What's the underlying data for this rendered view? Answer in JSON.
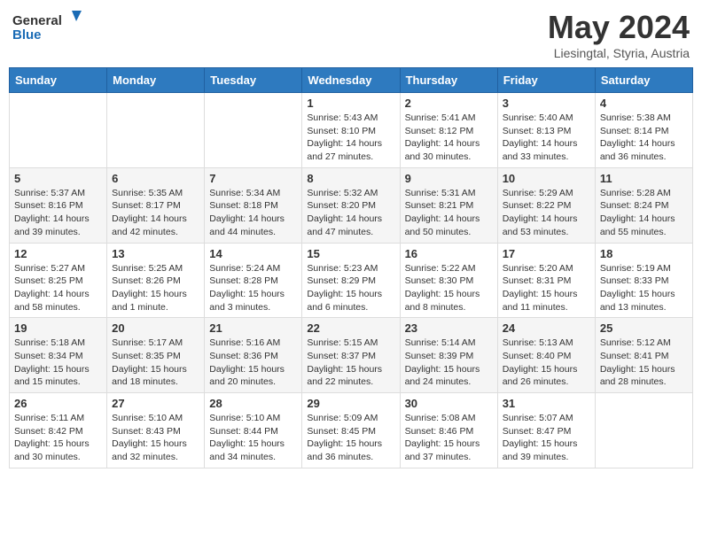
{
  "logo": {
    "line1": "General",
    "line2": "Blue"
  },
  "title": "May 2024",
  "location": "Liesingtal, Styria, Austria",
  "days_of_week": [
    "Sunday",
    "Monday",
    "Tuesday",
    "Wednesday",
    "Thursday",
    "Friday",
    "Saturday"
  ],
  "weeks": [
    [
      {
        "day": "",
        "info": ""
      },
      {
        "day": "",
        "info": ""
      },
      {
        "day": "",
        "info": ""
      },
      {
        "day": "1",
        "info": "Sunrise: 5:43 AM\nSunset: 8:10 PM\nDaylight: 14 hours\nand 27 minutes."
      },
      {
        "day": "2",
        "info": "Sunrise: 5:41 AM\nSunset: 8:12 PM\nDaylight: 14 hours\nand 30 minutes."
      },
      {
        "day": "3",
        "info": "Sunrise: 5:40 AM\nSunset: 8:13 PM\nDaylight: 14 hours\nand 33 minutes."
      },
      {
        "day": "4",
        "info": "Sunrise: 5:38 AM\nSunset: 8:14 PM\nDaylight: 14 hours\nand 36 minutes."
      }
    ],
    [
      {
        "day": "5",
        "info": "Sunrise: 5:37 AM\nSunset: 8:16 PM\nDaylight: 14 hours\nand 39 minutes."
      },
      {
        "day": "6",
        "info": "Sunrise: 5:35 AM\nSunset: 8:17 PM\nDaylight: 14 hours\nand 42 minutes."
      },
      {
        "day": "7",
        "info": "Sunrise: 5:34 AM\nSunset: 8:18 PM\nDaylight: 14 hours\nand 44 minutes."
      },
      {
        "day": "8",
        "info": "Sunrise: 5:32 AM\nSunset: 8:20 PM\nDaylight: 14 hours\nand 47 minutes."
      },
      {
        "day": "9",
        "info": "Sunrise: 5:31 AM\nSunset: 8:21 PM\nDaylight: 14 hours\nand 50 minutes."
      },
      {
        "day": "10",
        "info": "Sunrise: 5:29 AM\nSunset: 8:22 PM\nDaylight: 14 hours\nand 53 minutes."
      },
      {
        "day": "11",
        "info": "Sunrise: 5:28 AM\nSunset: 8:24 PM\nDaylight: 14 hours\nand 55 minutes."
      }
    ],
    [
      {
        "day": "12",
        "info": "Sunrise: 5:27 AM\nSunset: 8:25 PM\nDaylight: 14 hours\nand 58 minutes."
      },
      {
        "day": "13",
        "info": "Sunrise: 5:25 AM\nSunset: 8:26 PM\nDaylight: 15 hours\nand 1 minute."
      },
      {
        "day": "14",
        "info": "Sunrise: 5:24 AM\nSunset: 8:28 PM\nDaylight: 15 hours\nand 3 minutes."
      },
      {
        "day": "15",
        "info": "Sunrise: 5:23 AM\nSunset: 8:29 PM\nDaylight: 15 hours\nand 6 minutes."
      },
      {
        "day": "16",
        "info": "Sunrise: 5:22 AM\nSunset: 8:30 PM\nDaylight: 15 hours\nand 8 minutes."
      },
      {
        "day": "17",
        "info": "Sunrise: 5:20 AM\nSunset: 8:31 PM\nDaylight: 15 hours\nand 11 minutes."
      },
      {
        "day": "18",
        "info": "Sunrise: 5:19 AM\nSunset: 8:33 PM\nDaylight: 15 hours\nand 13 minutes."
      }
    ],
    [
      {
        "day": "19",
        "info": "Sunrise: 5:18 AM\nSunset: 8:34 PM\nDaylight: 15 hours\nand 15 minutes."
      },
      {
        "day": "20",
        "info": "Sunrise: 5:17 AM\nSunset: 8:35 PM\nDaylight: 15 hours\nand 18 minutes."
      },
      {
        "day": "21",
        "info": "Sunrise: 5:16 AM\nSunset: 8:36 PM\nDaylight: 15 hours\nand 20 minutes."
      },
      {
        "day": "22",
        "info": "Sunrise: 5:15 AM\nSunset: 8:37 PM\nDaylight: 15 hours\nand 22 minutes."
      },
      {
        "day": "23",
        "info": "Sunrise: 5:14 AM\nSunset: 8:39 PM\nDaylight: 15 hours\nand 24 minutes."
      },
      {
        "day": "24",
        "info": "Sunrise: 5:13 AM\nSunset: 8:40 PM\nDaylight: 15 hours\nand 26 minutes."
      },
      {
        "day": "25",
        "info": "Sunrise: 5:12 AM\nSunset: 8:41 PM\nDaylight: 15 hours\nand 28 minutes."
      }
    ],
    [
      {
        "day": "26",
        "info": "Sunrise: 5:11 AM\nSunset: 8:42 PM\nDaylight: 15 hours\nand 30 minutes."
      },
      {
        "day": "27",
        "info": "Sunrise: 5:10 AM\nSunset: 8:43 PM\nDaylight: 15 hours\nand 32 minutes."
      },
      {
        "day": "28",
        "info": "Sunrise: 5:10 AM\nSunset: 8:44 PM\nDaylight: 15 hours\nand 34 minutes."
      },
      {
        "day": "29",
        "info": "Sunrise: 5:09 AM\nSunset: 8:45 PM\nDaylight: 15 hours\nand 36 minutes."
      },
      {
        "day": "30",
        "info": "Sunrise: 5:08 AM\nSunset: 8:46 PM\nDaylight: 15 hours\nand 37 minutes."
      },
      {
        "day": "31",
        "info": "Sunrise: 5:07 AM\nSunset: 8:47 PM\nDaylight: 15 hours\nand 39 minutes."
      },
      {
        "day": "",
        "info": ""
      }
    ]
  ]
}
